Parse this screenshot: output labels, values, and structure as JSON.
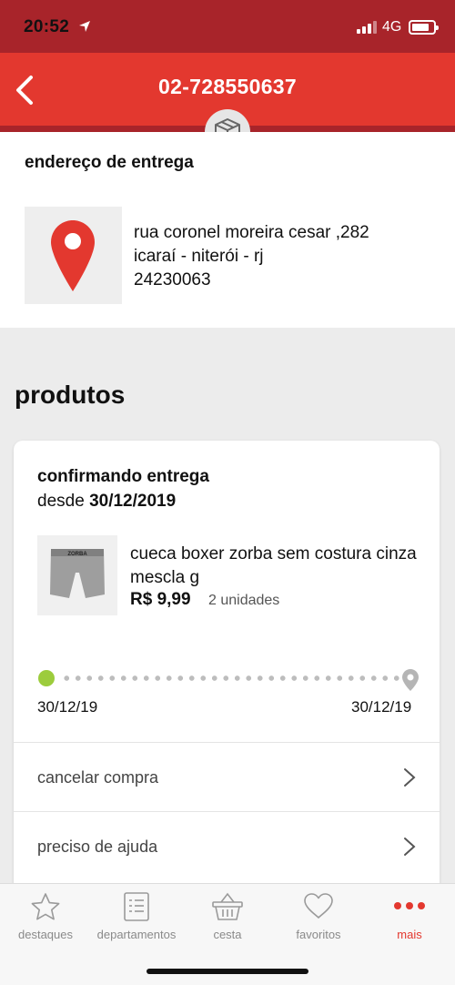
{
  "status_bar": {
    "time": "20:52",
    "network": "4G"
  },
  "header": {
    "title": "02-728550637"
  },
  "address": {
    "heading": "endereço de entrega",
    "line1": "rua coronel moreira cesar ,282",
    "line2": "icaraí - niterói - rj",
    "line3": "24230063"
  },
  "products": {
    "heading": "produtos",
    "status": {
      "title": "confirmando entrega",
      "since_label": "desde",
      "since_date": "30/12/2019"
    },
    "item": {
      "image_text": "ZORBA",
      "name": "cueca boxer zorba sem costura cinza mescla g",
      "price": "R$ 9,99",
      "quantity": "2 unidades"
    },
    "tracking": {
      "start_date": "30/12/19",
      "end_date": "30/12/19",
      "progress": 0
    },
    "actions": [
      {
        "label": "cancelar compra"
      },
      {
        "label": "preciso de ajuda"
      }
    ]
  },
  "tab_bar": {
    "tabs": [
      {
        "label": "destaques",
        "icon": "star-icon"
      },
      {
        "label": "departamentos",
        "icon": "list-icon"
      },
      {
        "label": "cesta",
        "icon": "basket-icon"
      },
      {
        "label": "favoritos",
        "icon": "heart-icon"
      },
      {
        "label": "mais",
        "icon": "more-dots-icon",
        "active": true
      }
    ]
  },
  "colors": {
    "brand_red": "#e3382f",
    "dark_red": "#a8242a",
    "progress_green": "#9ccc3c"
  }
}
